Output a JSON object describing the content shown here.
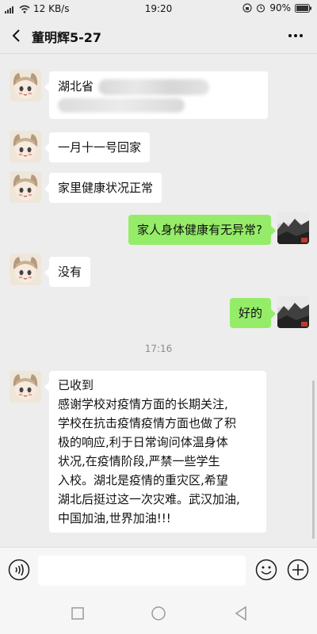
{
  "status_bar": {
    "network_speed": "12 KB/s",
    "time": "19:20",
    "battery": "90%"
  },
  "header": {
    "title": "董明辉5-27"
  },
  "messages": [
    {
      "side": "left",
      "text_lines": [
        "湖北省"
      ]
    },
    {
      "side": "left",
      "text_lines": [
        "一月十一号回家"
      ]
    },
    {
      "side": "left",
      "text_lines": [
        "家里健康状况正常"
      ]
    },
    {
      "side": "right",
      "text_lines": [
        "家人身体健康有无异常?"
      ]
    },
    {
      "side": "left",
      "text_lines": [
        "没有"
      ]
    },
    {
      "side": "right",
      "text_lines": [
        "好的"
      ]
    },
    {
      "side": "left",
      "text_lines": [
        "已收到",
        "感谢学校对疫情方面的长期关注,",
        "学校在抗击疫情疫情方面也做了积",
        "极的响应,利于日常询问体温身体",
        "状况,在疫情阶段,严禁一些学生",
        "入校。湖北是疫情的重灾区,希望",
        "湖北后挺过这一次灾难。武汉加油,",
        "中国加油,世界加油!!!"
      ]
    }
  ],
  "timestamp": "17:16",
  "input": {
    "value": "",
    "placeholder": ""
  },
  "colors": {
    "background": "#ededed",
    "sent_bubble": "#95ec69",
    "received_bubble": "#ffffff",
    "timestamp_text": "#8c8c8c"
  },
  "icons": {
    "back": "chevron-left-icon",
    "more": "more-dots-icon",
    "voice": "voice-icon",
    "emoji": "emoji-icon",
    "plus": "plus-icon",
    "nav_recent": "square-icon",
    "nav_home": "circle-icon",
    "nav_back": "triangle-back-icon"
  }
}
